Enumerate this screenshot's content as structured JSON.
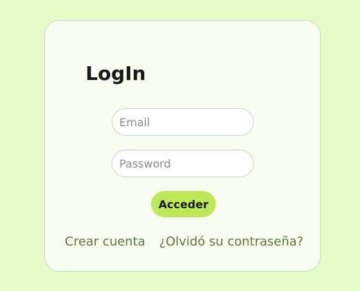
{
  "login": {
    "title": "LogIn",
    "email_placeholder": "Email",
    "password_placeholder": "Password",
    "submit_label": "Acceder",
    "create_account_label": "Crear cuenta",
    "forgot_password_label": "¿Olvidó su contraseña?"
  },
  "colors": {
    "background": "#e3fcc8",
    "card": "#f7fef1",
    "button": "#bde85c",
    "link": "#5a7a3a"
  }
}
